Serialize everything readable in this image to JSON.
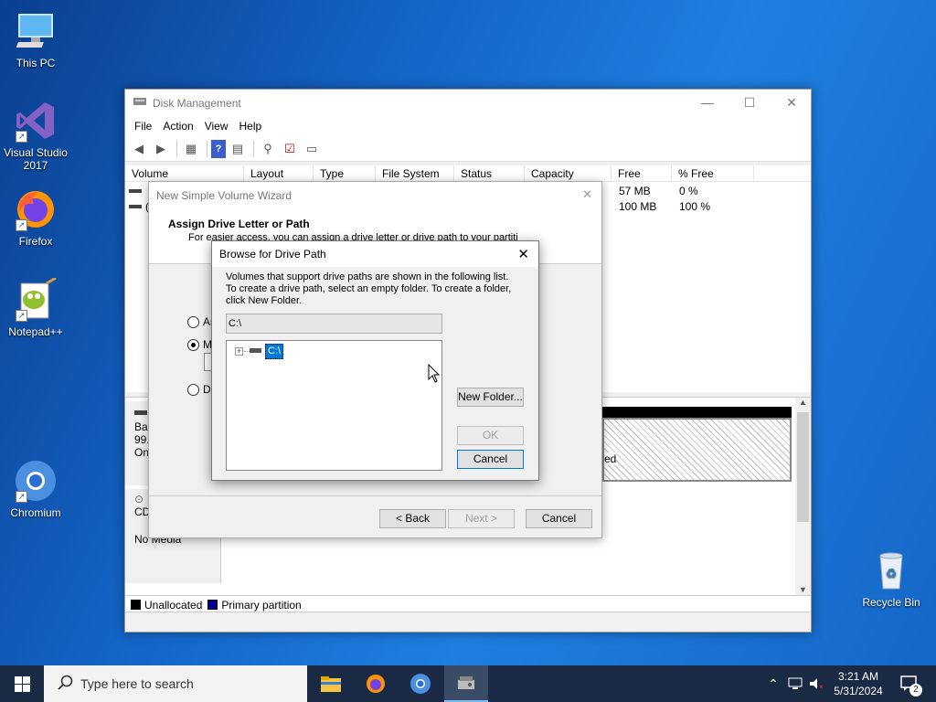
{
  "desktop": {
    "icons": [
      {
        "label": "This PC",
        "icon": "computer-icon"
      },
      {
        "label": "Visual Studio 2017",
        "icon": "visual-studio-icon"
      },
      {
        "label": "Firefox",
        "icon": "firefox-icon"
      },
      {
        "label": "Notepad++",
        "icon": "notepadpp-icon"
      },
      {
        "label": "Chromium",
        "icon": "chromium-icon"
      },
      {
        "label": "Recycle Bin",
        "icon": "recycle-bin-icon"
      }
    ]
  },
  "disk_management": {
    "title": "Disk Management",
    "menu": [
      "File",
      "Action",
      "View",
      "Help"
    ],
    "columns": [
      "Volume",
      "Layout",
      "Type",
      "File System",
      "Status",
      "Capacity",
      "Free Spa...",
      "% Free"
    ],
    "rows": [
      {
        "free": "57 MB",
        "pct": "0 %"
      },
      {
        "volume_fragment": "(",
        "free": "100 MB",
        "pct": "100 %"
      }
    ],
    "disk0_label": [
      "Bas",
      "99.",
      "On"
    ],
    "disk_fragment": "ed",
    "cdrom_label": "CD",
    "cdrom_status": "No Media",
    "legend": [
      {
        "label": "Unallocated",
        "color": "#000000"
      },
      {
        "label": "Primary partition",
        "color": "#00008b"
      }
    ]
  },
  "wizard": {
    "title": "New Simple Volume Wizard",
    "heading": "Assign Drive Letter or Path",
    "subheading": "For easier access, you can assign a drive letter or drive path to your partition.",
    "options": [
      "As",
      "Mo",
      "Do"
    ],
    "back": "< Back",
    "next": "Next >",
    "cancel": "Cancel"
  },
  "browse": {
    "title": "Browse for Drive Path",
    "desc1": "Volumes that support drive paths are shown in the following list.",
    "desc2": "To create a drive path, select an empty folder. To create a folder,",
    "desc3": "click New Folder.",
    "path_value": "C:\\",
    "tree_item": "C:\\",
    "new_folder": "New Folder...",
    "ok": "OK",
    "cancel": "Cancel"
  },
  "taskbar": {
    "search_placeholder": "Type here to search",
    "time": "3:21 AM",
    "date": "5/31/2024",
    "notification_count": "2"
  }
}
